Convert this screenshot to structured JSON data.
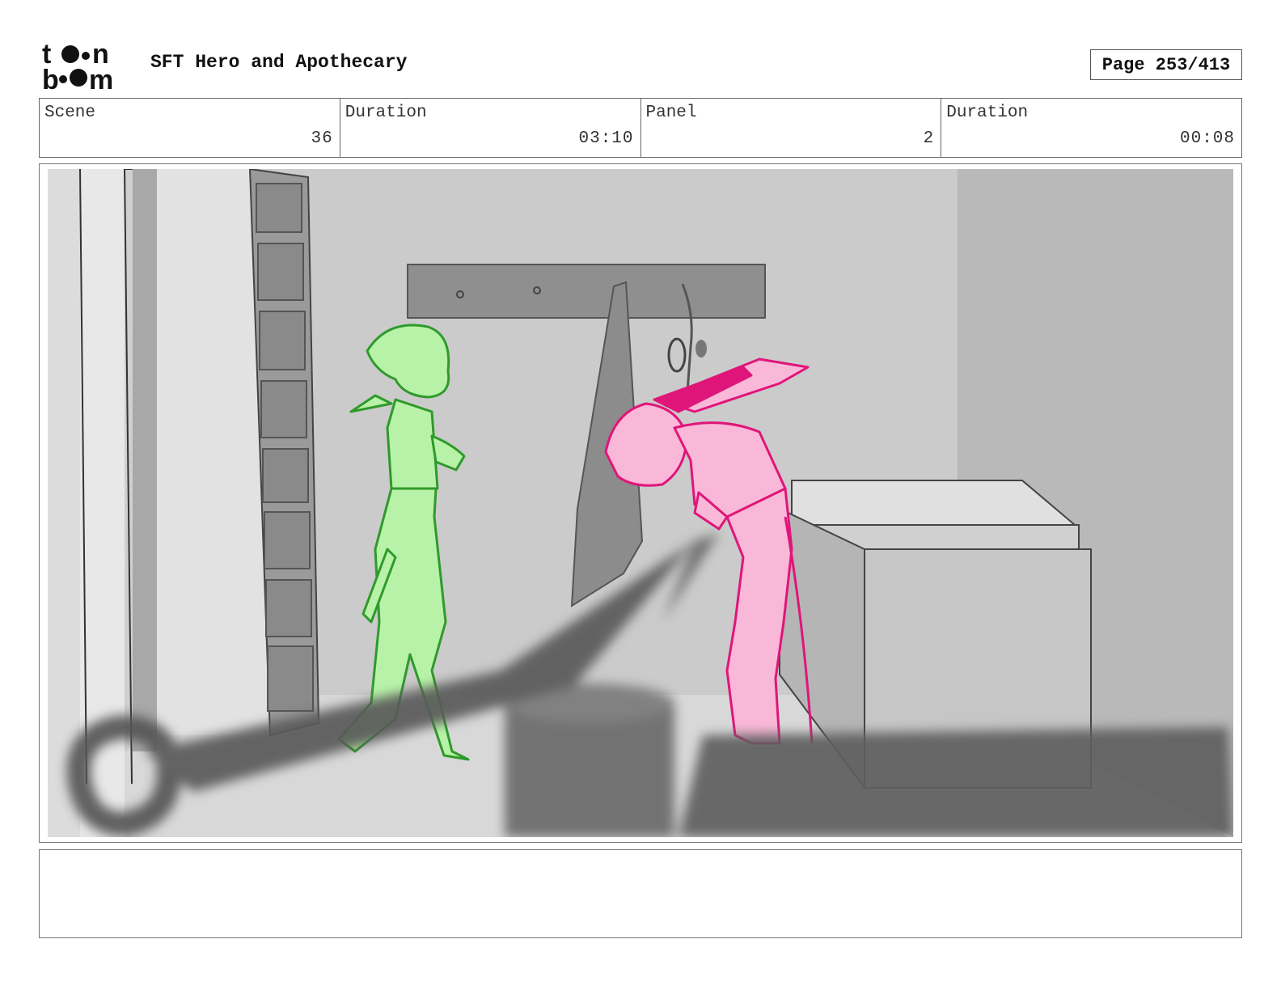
{
  "header": {
    "logo_name": "toon-boom-logo",
    "title": "SFT Hero and Apothecary",
    "page_label": "Page 253/413"
  },
  "info": {
    "scene_label": "Scene",
    "scene_value": "36",
    "scene_duration_label": "Duration",
    "scene_duration_value": "03:10",
    "panel_label": "Panel",
    "panel_value": "2",
    "panel_duration_label": "Duration",
    "panel_duration_value": "00:08"
  },
  "notes": {
    "text": ""
  },
  "colors": {
    "green_character": "#b8f2a8",
    "pink_character": "#f9b8d8",
    "pink_ink": "#e0157a",
    "green_ink": "#2f9a2a"
  }
}
